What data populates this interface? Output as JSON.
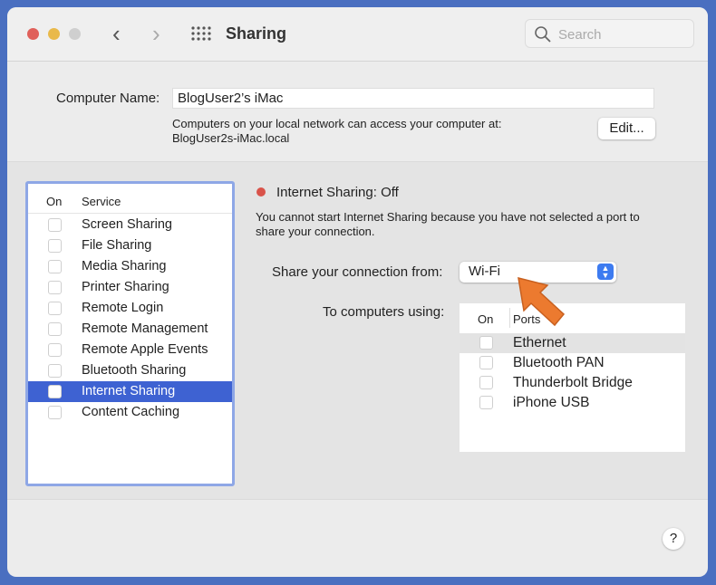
{
  "window": {
    "title": "Sharing",
    "search_placeholder": "Search"
  },
  "computer_name": {
    "label": "Computer Name:",
    "value": "BlogUser2’s iMac",
    "info_line1": "Computers on your local network can access your computer at:",
    "info_line2": "BlogUser2s-iMac.local",
    "edit_label": "Edit..."
  },
  "services": {
    "header_on": "On",
    "header_service": "Service",
    "items": [
      {
        "label": "Screen Sharing",
        "on": false
      },
      {
        "label": "File Sharing",
        "on": false
      },
      {
        "label": "Media Sharing",
        "on": false
      },
      {
        "label": "Printer Sharing",
        "on": false
      },
      {
        "label": "Remote Login",
        "on": false
      },
      {
        "label": "Remote Management",
        "on": false
      },
      {
        "label": "Remote Apple Events",
        "on": false
      },
      {
        "label": "Bluetooth Sharing",
        "on": false
      },
      {
        "label": "Internet Sharing",
        "on": false,
        "selected": true
      },
      {
        "label": "Content Caching",
        "on": false
      }
    ]
  },
  "detail": {
    "status": "Internet Sharing: Off",
    "status_color": "#d9534a",
    "message1": "You cannot start Internet Sharing because you have not selected a port to",
    "message2": "share your connection.",
    "share_from_label": "Share your connection from:",
    "share_from_value": "Wi-Fi",
    "to_label": "To computers using:",
    "ports_header_on": "On",
    "ports_header_ports": "Ports",
    "ports": [
      {
        "label": "Ethernet",
        "on": false
      },
      {
        "label": "Bluetooth PAN",
        "on": false
      },
      {
        "label": "Thunderbolt Bridge",
        "on": false
      },
      {
        "label": "iPhone USB",
        "on": false
      }
    ]
  },
  "help_label": "?"
}
